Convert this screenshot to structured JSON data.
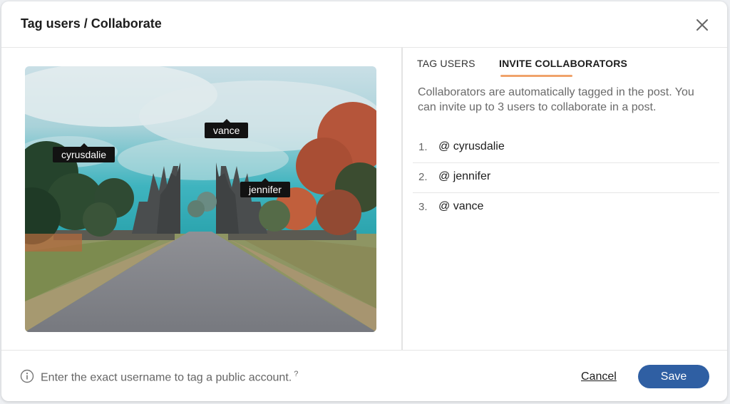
{
  "header": {
    "title": "Tag users / Collaborate",
    "close_icon": "close-icon"
  },
  "photo": {
    "tags": [
      {
        "username": "cyrusdalie"
      },
      {
        "username": "vance"
      },
      {
        "username": "jennifer"
      }
    ]
  },
  "tabs": [
    {
      "label": "TAG USERS",
      "active": false
    },
    {
      "label": "INVITE COLLABORATORS",
      "active": true
    }
  ],
  "invite": {
    "description": "Collaborators are automatically tagged in the post. You can invite up to 3 users to collaborate in a post.",
    "collaborators": [
      {
        "number": "1.",
        "name": "@ cyrusdalie"
      },
      {
        "number": "2.",
        "name": "@ jennifer"
      },
      {
        "number": "3.",
        "name": "@ vance"
      }
    ]
  },
  "footer": {
    "info_icon": "info-icon",
    "hint": "Enter the exact username to tag a public account.",
    "hint_marker": "?",
    "cancel_label": "Cancel",
    "save_label": "Save"
  },
  "colors": {
    "accent_tab": "#f0a36b",
    "save_button": "#2f5fa3",
    "tag_bg": "#121212"
  }
}
